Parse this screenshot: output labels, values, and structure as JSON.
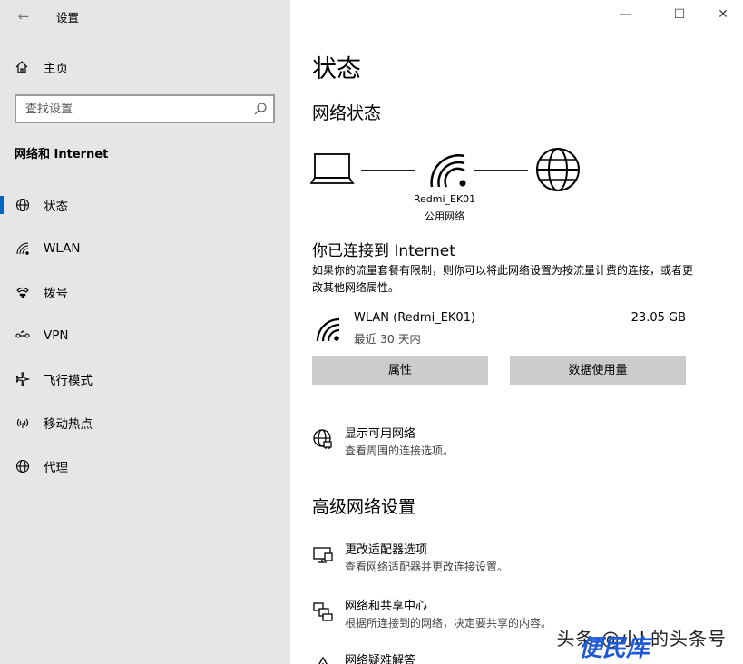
{
  "window": {
    "title": "设置"
  },
  "sidebar": {
    "home_label": "主页",
    "search_placeholder": "查找设置",
    "section_label": "网络和 Internet",
    "items": [
      {
        "label": "状态",
        "icon": "globe-icon",
        "selected": true
      },
      {
        "label": "WLAN",
        "icon": "wifi-icon",
        "selected": false
      },
      {
        "label": "拨号",
        "icon": "dialup-icon",
        "selected": false
      },
      {
        "label": "VPN",
        "icon": "vpn-icon",
        "selected": false
      },
      {
        "label": "飞行模式",
        "icon": "airplane-icon",
        "selected": false
      },
      {
        "label": "移动热点",
        "icon": "hotspot-icon",
        "selected": false
      },
      {
        "label": "代理",
        "icon": "globe-icon",
        "selected": false
      }
    ]
  },
  "main": {
    "page_title": "状态",
    "network_status_heading": "网络状态",
    "network_name": "Redmi_EK01",
    "network_type": "公用网络",
    "connected_heading": "你已连接到 Internet",
    "connected_desc": "如果你的流量套餐有限制，则你可以将此网络设置为按流量计费的连接，或者更改其他网络属性。",
    "adapter": {
      "name": "WLAN (Redmi_EK01)",
      "period": "最近 30 天内",
      "usage": "23.05 GB"
    },
    "buttons": {
      "properties": "属性",
      "data_usage": "数据使用量"
    },
    "show_networks": {
      "title": "显示可用网络",
      "desc": "查看周围的连接选项。"
    },
    "advanced_heading": "高级网络设置",
    "advanced_items": [
      {
        "title": "更改适配器选项",
        "desc": "查看网络适配器并更改连接设置。"
      },
      {
        "title": "网络和共享中心",
        "desc": "根据所连接到的网络，决定要共享的内容。"
      },
      {
        "title": "网络疑难解答",
        "desc": ""
      }
    ]
  },
  "watermark": {
    "text": "头条 @小L的头条号",
    "overlay": "便民库"
  },
  "colors": {
    "sidebar_bg": "#e6e6e6",
    "accent": "#0067c0",
    "button_bg": "#cccccc"
  }
}
